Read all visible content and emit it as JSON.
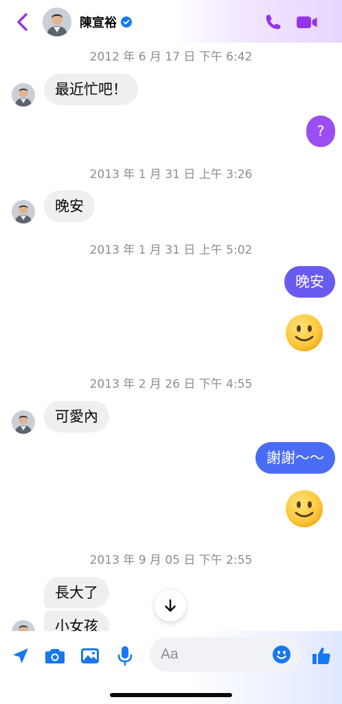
{
  "header": {
    "contact_name": "陳宣裕",
    "accent_color": "#9333ea",
    "verified_color": "#1877f2"
  },
  "messages": [
    {
      "type": "timestamp",
      "text": "2012 年 6 月 17 日 下午 6:42"
    },
    {
      "type": "incoming",
      "text": "最近忙吧！"
    },
    {
      "type": "outgoing",
      "text": "?",
      "color": "#9b4ef2"
    },
    {
      "type": "timestamp",
      "text": "2013 年 1 月 31 日 上午 3:26"
    },
    {
      "type": "incoming",
      "text": "晚安"
    },
    {
      "type": "timestamp",
      "text": "2013 年 1 月 31 日 上午 5:02"
    },
    {
      "type": "outgoing",
      "text": "晚安",
      "color": "#6a5bf0"
    },
    {
      "type": "emoji",
      "name": "slightly-smiling-face"
    },
    {
      "type": "timestamp",
      "text": "2013 年 2 月 26 日 下午 4:55"
    },
    {
      "type": "incoming",
      "text": "可愛內"
    },
    {
      "type": "outgoing",
      "text": "謝謝～～",
      "color": "#4a6cf5"
    },
    {
      "type": "emoji",
      "name": "slightly-smiling-face"
    },
    {
      "type": "timestamp",
      "text": "2013 年 9 月 05 日 下午 2:55"
    },
    {
      "type": "incoming",
      "text": "長大了"
    },
    {
      "type": "incoming",
      "text": "小女孩"
    }
  ],
  "composer": {
    "placeholder": "Aa",
    "icon_color": "#1877f2",
    "buttons": [
      "location-icon",
      "camera-icon",
      "gallery-icon",
      "microphone-icon",
      "emoji-icon",
      "like-icon"
    ]
  }
}
